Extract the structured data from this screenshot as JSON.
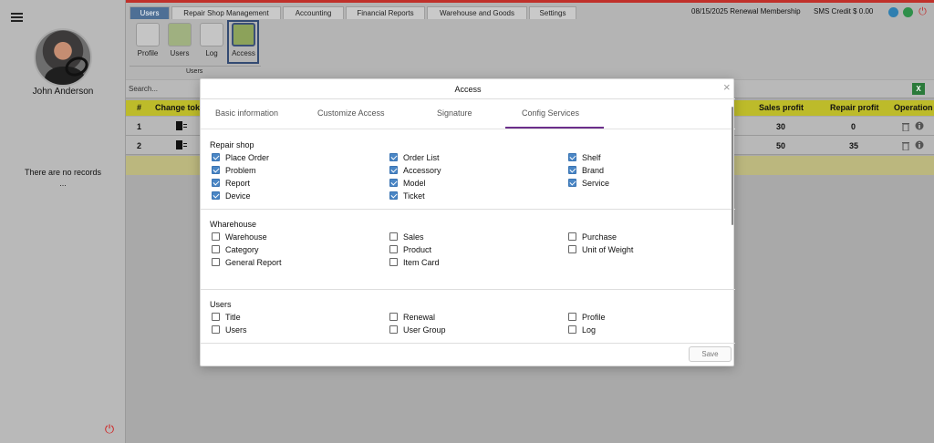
{
  "sidebar": {
    "user_name": "John Anderson",
    "empty_text": "There are no records",
    "empty_dots": "..."
  },
  "top_tabs": [
    {
      "label": "Users",
      "active": true
    },
    {
      "label": "Repair Shop Management"
    },
    {
      "label": "Accounting"
    },
    {
      "label": "Financial Reports"
    },
    {
      "label": "Warehouse and Goods"
    },
    {
      "label": "Settings"
    }
  ],
  "header": {
    "membership": "08/15/2025 Renewal Membership",
    "sms_credit": "SMS Credit $ 0.00"
  },
  "toolbar": {
    "items": [
      {
        "label": "Profile"
      },
      {
        "label": "Users"
      },
      {
        "label": "Log"
      },
      {
        "label": "Access"
      }
    ],
    "group_label": "Users"
  },
  "search": {
    "placeholder": "Search..."
  },
  "table": {
    "headers": [
      "#",
      "Change tok",
      "Sales profit",
      "Repair profit",
      "Operation"
    ],
    "rows": [
      {
        "num": "1",
        "sales_profit": "30",
        "repair_profit": "0"
      },
      {
        "num": "2",
        "sales_profit": "50",
        "repair_profit": "35"
      }
    ]
  },
  "modal": {
    "title": "Access",
    "tabs": [
      "Basic information",
      "Customize Access",
      "Signature",
      "Config Services"
    ],
    "active_tab": "Config Services",
    "sections": [
      {
        "title": "Repair shop",
        "items": [
          {
            "label": "Place Order",
            "checked": true
          },
          {
            "label": "Order List",
            "checked": true
          },
          {
            "label": "Shelf",
            "checked": true
          },
          {
            "label": "Problem",
            "checked": true
          },
          {
            "label": "Accessory",
            "checked": true
          },
          {
            "label": "Brand",
            "checked": true
          },
          {
            "label": "Report",
            "checked": true
          },
          {
            "label": "Model",
            "checked": true
          },
          {
            "label": "Service",
            "checked": true
          },
          {
            "label": "Device",
            "checked": true
          },
          {
            "label": "Ticket",
            "checked": true
          }
        ]
      },
      {
        "title": "Wharehouse",
        "items": [
          {
            "label": "Warehouse",
            "checked": false
          },
          {
            "label": "Sales",
            "checked": false
          },
          {
            "label": "Purchase",
            "checked": false
          },
          {
            "label": "Category",
            "checked": false
          },
          {
            "label": "Product",
            "checked": false
          },
          {
            "label": "Unit of Weight",
            "checked": false
          },
          {
            "label": "General Report",
            "checked": false
          },
          {
            "label": "Item Card",
            "checked": false
          }
        ]
      },
      {
        "title": "Users",
        "items": [
          {
            "label": "Title",
            "checked": false
          },
          {
            "label": "Renewal",
            "checked": false
          },
          {
            "label": "Profile",
            "checked": false
          },
          {
            "label": "Users",
            "checked": false
          },
          {
            "label": "User Group",
            "checked": false
          },
          {
            "label": "Log",
            "checked": false
          }
        ]
      }
    ],
    "save_label": "Save"
  },
  "colors": {
    "active_tab": "#4e6f95",
    "table_header": "#bdbb2a",
    "checkbox_checked": "#4a86c5",
    "tab_underline": "#6b2e8a",
    "top_border": "#c0302a"
  }
}
